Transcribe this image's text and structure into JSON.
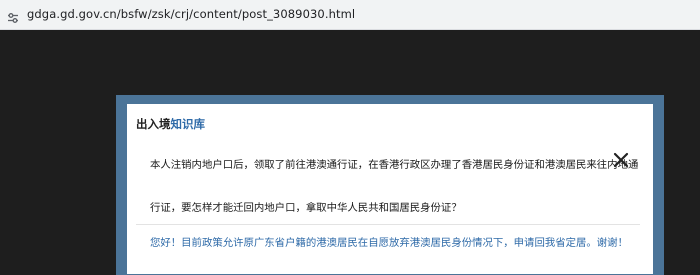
{
  "browser": {
    "url": "gdga.gd.gov.cn/bsfw/zsk/crj/content/post_3089030.html",
    "site_info_icon": "tune-icon"
  },
  "modal": {
    "title_prefix": "出入境",
    "title_accent": "知识库",
    "close_icon": "close-icon",
    "accent_color": "#2e6aa8",
    "frame_color": "#4b7498",
    "question_line_1": "本人注销内地户口后，领取了前往港澳通行证，在香港行政区办理了香港居民身份证和港澳居民来往内地通",
    "question_line_2": "行证，要怎样才能迁回内地户口，拿取中华人民共和国居民身份证？",
    "answer": "您好！目前政策允许原广东省户籍的港澳居民在自愿放弃港澳居民身份情况下，申请回我省定居。谢谢！"
  }
}
